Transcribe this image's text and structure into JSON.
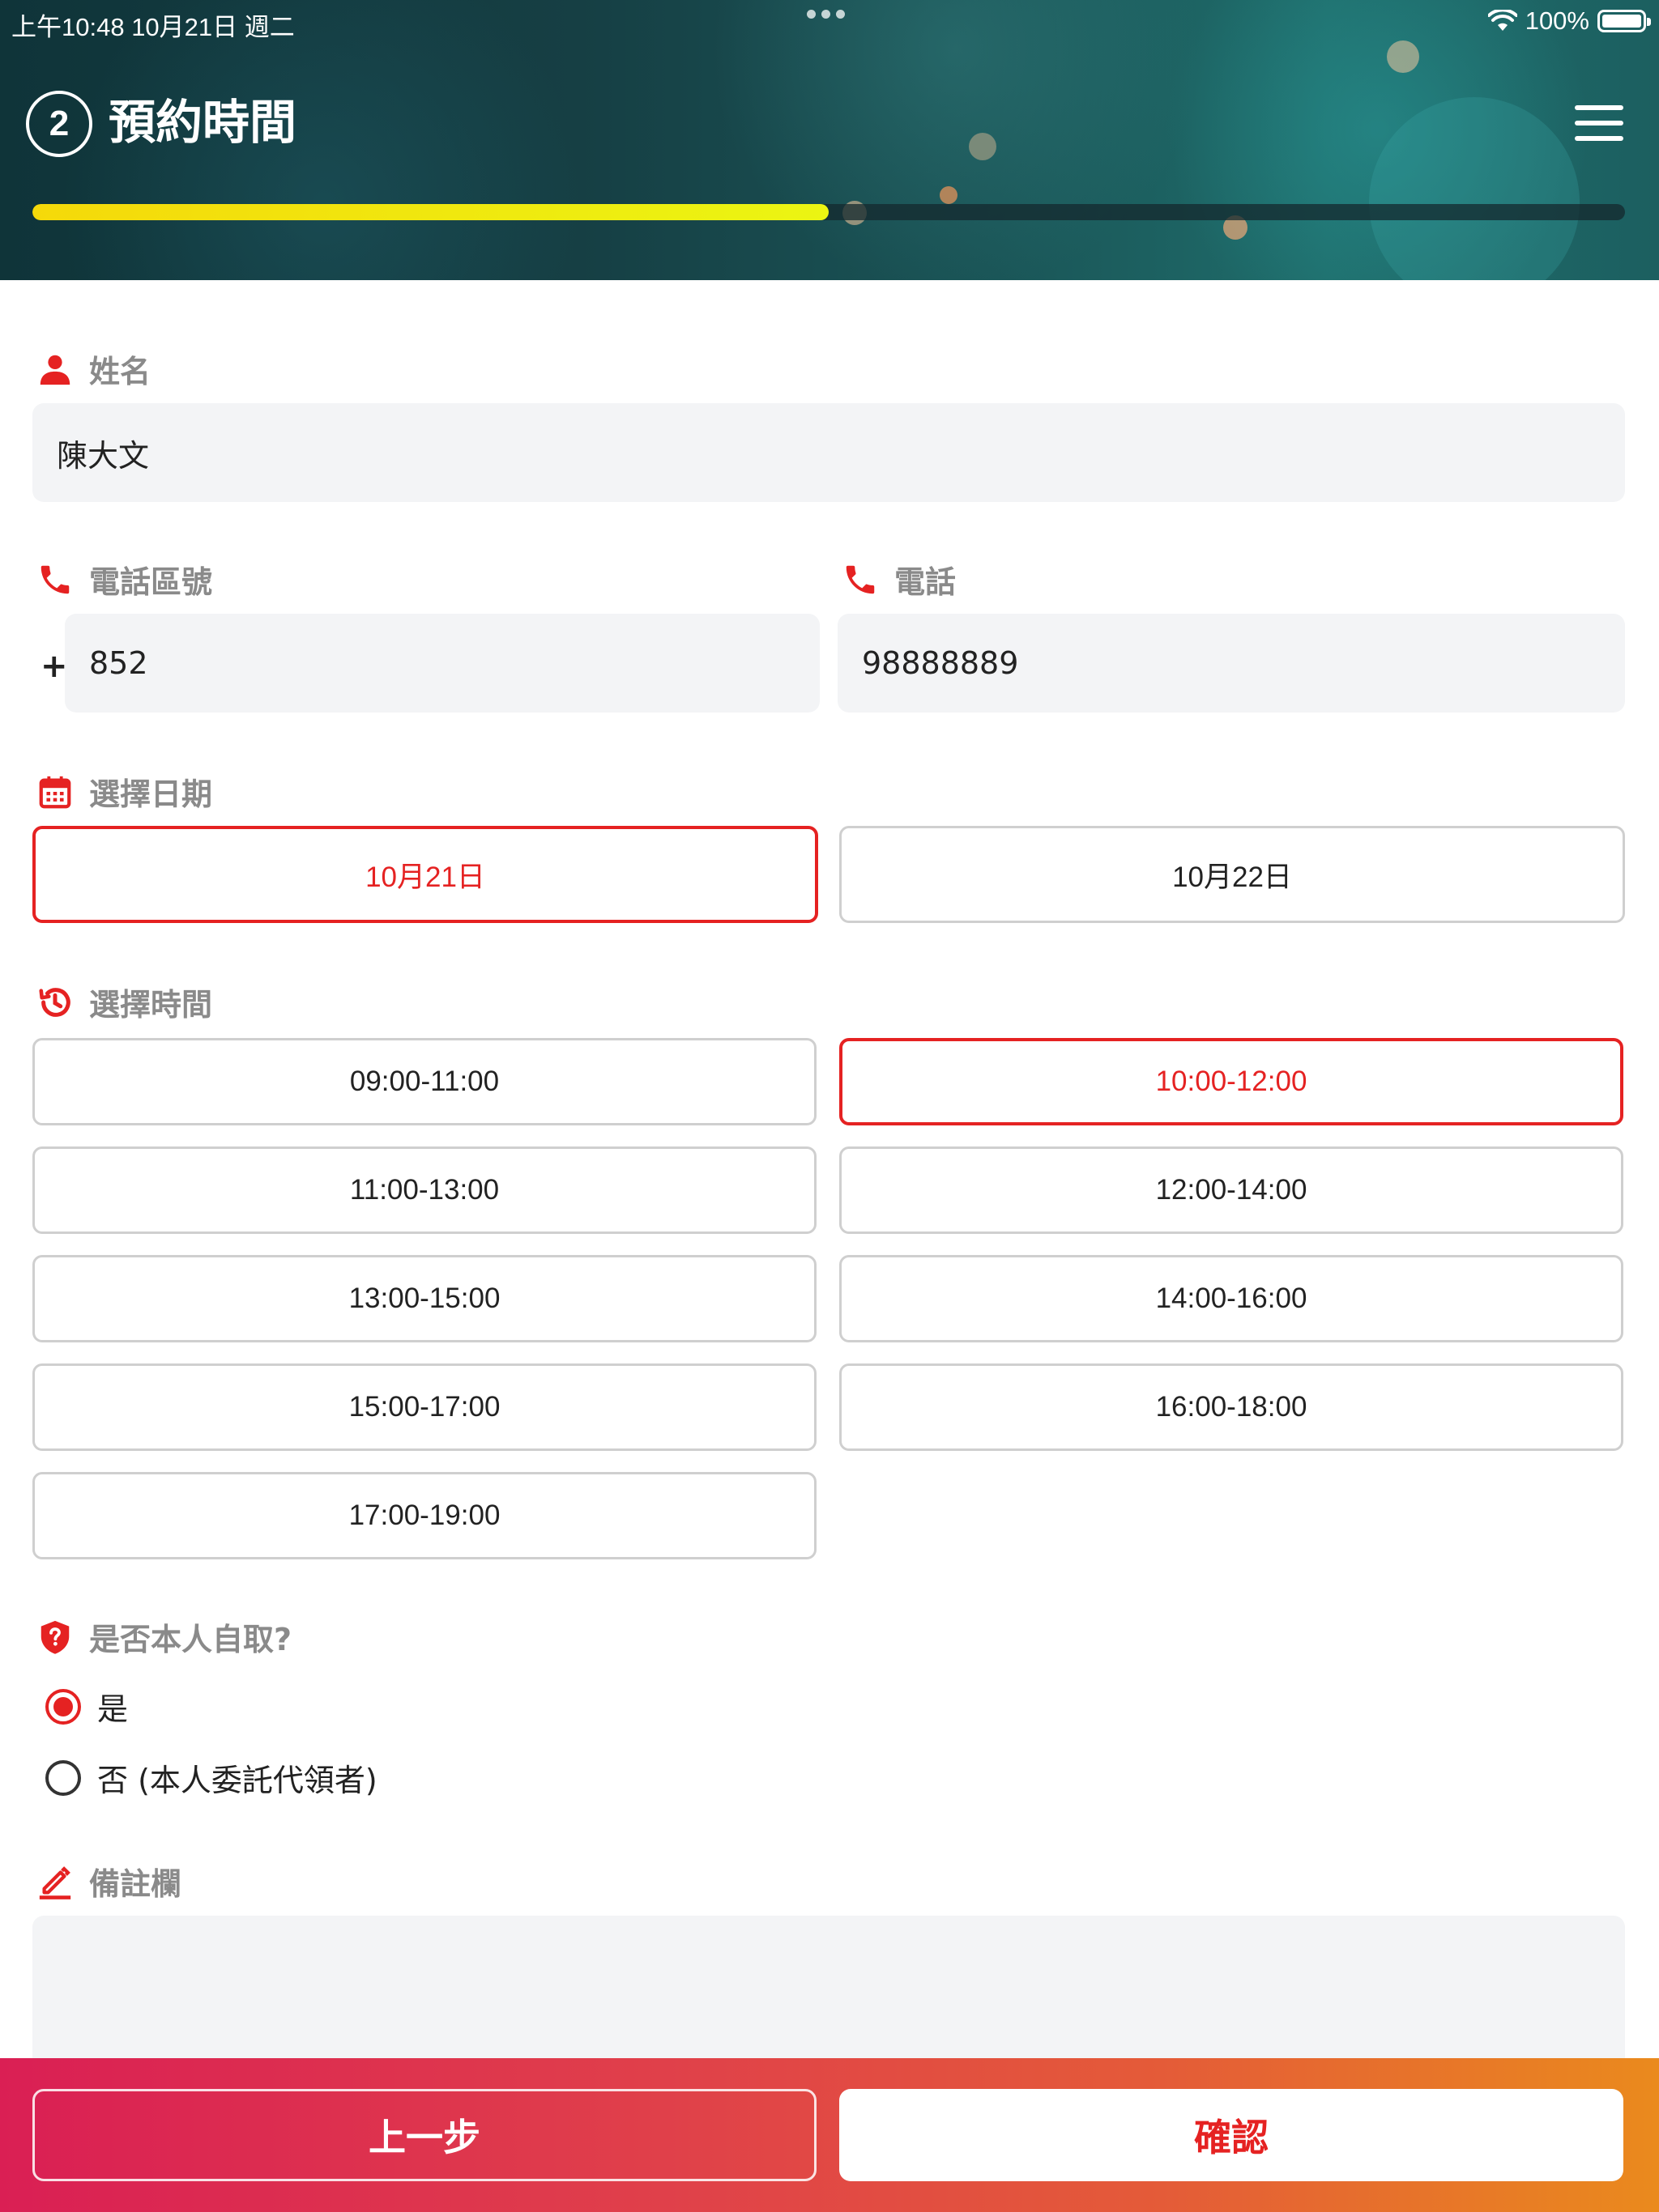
{
  "status_bar": {
    "time_date": "上午10:48   10月21日 週二",
    "battery": "100%"
  },
  "header": {
    "step_number": "2",
    "title": "預約時間",
    "progress_fraction": 0.5
  },
  "form": {
    "name": {
      "label": "姓名",
      "value": "陳大文"
    },
    "area_code": {
      "label": "電話區號",
      "prefix": "+",
      "value": "852"
    },
    "phone": {
      "label": "電話",
      "value": "98888889"
    },
    "date": {
      "label": "選擇日期",
      "options": [
        "10月21日",
        "10月22日"
      ],
      "selected": "10月21日"
    },
    "time": {
      "label": "選擇時間",
      "options": [
        "09:00-11:00",
        "10:00-12:00",
        "11:00-13:00",
        "12:00-14:00",
        "13:00-15:00",
        "14:00-16:00",
        "15:00-17:00",
        "16:00-18:00",
        "17:00-19:00"
      ],
      "selected": "10:00-12:00"
    },
    "self_pickup": {
      "label": "是否本人自取?",
      "options": [
        "是",
        "否 (本人委託代領者)"
      ],
      "selected": "是"
    },
    "remarks": {
      "label": "備註欄",
      "value": ""
    }
  },
  "footer": {
    "back_label": "上一步",
    "confirm_label": "確認"
  },
  "colors": {
    "accent_red": "#e52222",
    "progress_yellow": "#ebf512",
    "footer_gradient_start": "#da1f54",
    "footer_gradient_end": "#ea8a1d"
  }
}
